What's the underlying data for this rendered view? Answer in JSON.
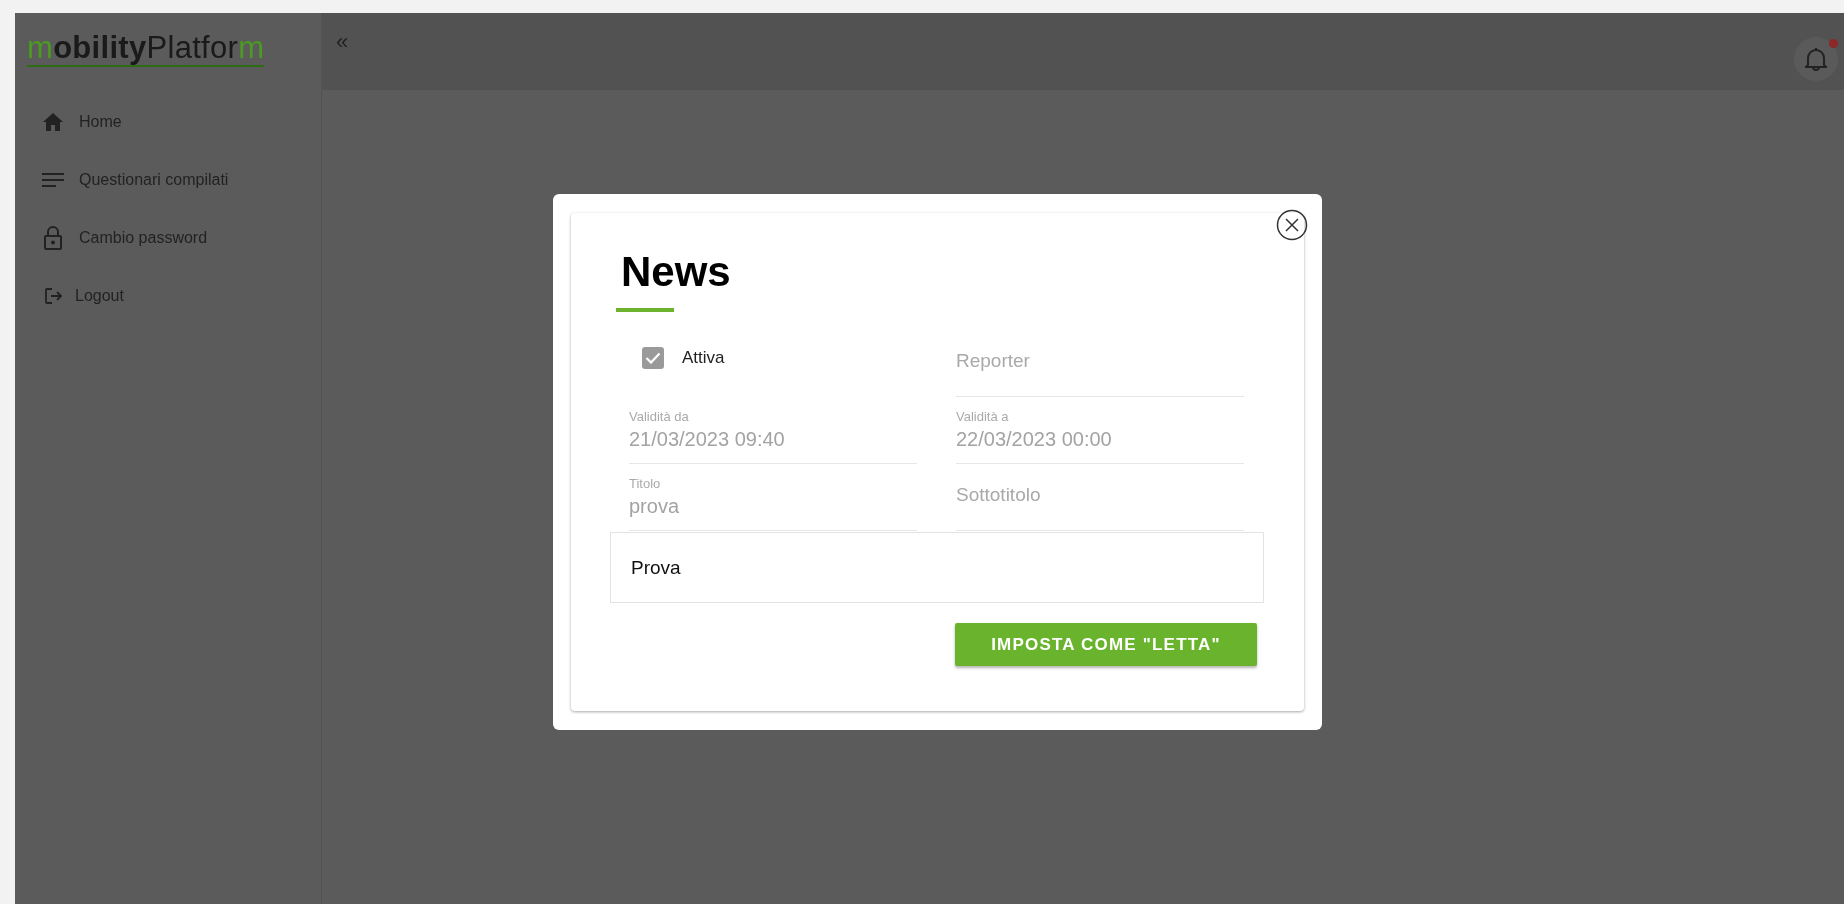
{
  "logo": {
    "parts": [
      {
        "text": "m",
        "kind": "accent"
      },
      {
        "text": "obility",
        "kind": "bold"
      },
      {
        "text": "Platfor",
        "kind": "plain"
      },
      {
        "text": "m",
        "kind": "accent"
      }
    ]
  },
  "sidebar": {
    "items": [
      {
        "label": "Home"
      },
      {
        "label": "Questionari compilati"
      },
      {
        "label": "Cambio password"
      },
      {
        "label": "Logout"
      }
    ]
  },
  "header": {
    "collapse": "«",
    "notifications": {
      "unread": true
    }
  },
  "modal": {
    "title": "News",
    "checkbox": {
      "label": "Attiva",
      "checked": true,
      "disabled": true
    },
    "fields": [
      {
        "label": "Reporter",
        "disabled": true
      },
      {
        "label": "Validità da",
        "value": "21/03/2023 09:40",
        "disabled": true
      },
      {
        "label": "Validità a",
        "value": "22/03/2023 00:00",
        "disabled": true
      },
      {
        "label": "Titolo",
        "value": "prova",
        "disabled": true
      },
      {
        "label": "Sottotitolo",
        "disabled": true
      }
    ],
    "body": "Prova",
    "button": "IMPOSTA COME \"LETTA\""
  }
}
